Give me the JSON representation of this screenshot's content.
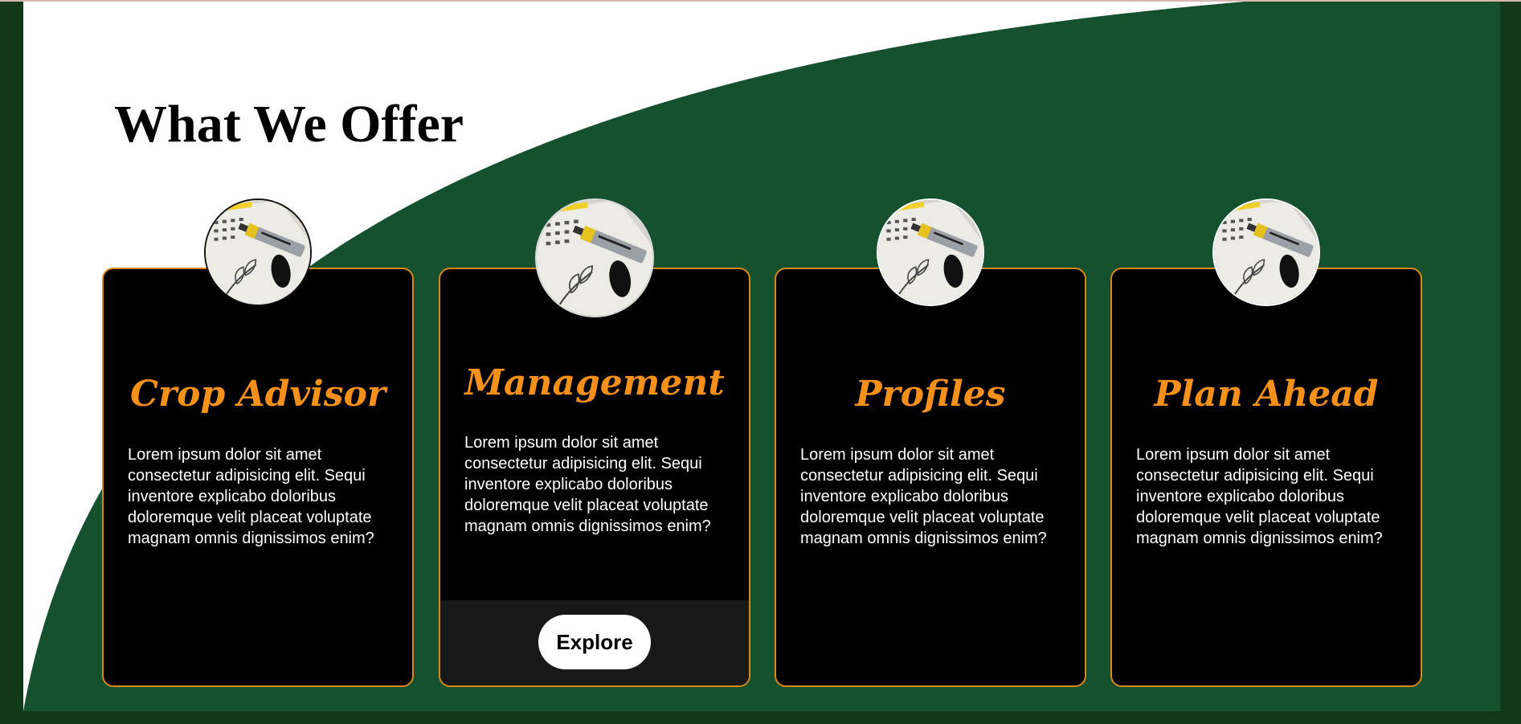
{
  "section": {
    "title": "What We Offer"
  },
  "colors": {
    "page_background": "#12381a",
    "panel_green": "#15512f",
    "card_background": "#000000",
    "card_border": "#d98a16",
    "card_title": "#f5901a",
    "explore_band": "#181818"
  },
  "cards": [
    {
      "title": "Crop Advisor",
      "text": "Lorem ipsum dolor sit amet consectetur adipisicing elit. Sequi inventore explicabo doloribus doloremque velit placeat voluptate magnam omnis dignissimos enim?",
      "image": "calendar-marker-photo"
    },
    {
      "title": "Management",
      "text": "Lorem ipsum dolor sit amet consectetur adipisicing elit. Sequi inventore explicabo doloribus doloremque velit placeat voluptate magnam omnis dignissimos enim?",
      "image": "calendar-marker-photo",
      "button_label": "Explore"
    },
    {
      "title": "Profiles",
      "text": "Lorem ipsum dolor sit amet consectetur adipisicing elit. Sequi inventore explicabo doloribus doloremque velit placeat voluptate magnam omnis dignissimos enim?",
      "image": "calendar-marker-photo"
    },
    {
      "title": "Plan Ahead",
      "text": "Lorem ipsum dolor sit amet consectetur adipisicing elit. Sequi inventore explicabo doloribus doloremque velit placeat voluptate magnam omnis dignissimos enim?",
      "image": "calendar-marker-photo"
    }
  ]
}
